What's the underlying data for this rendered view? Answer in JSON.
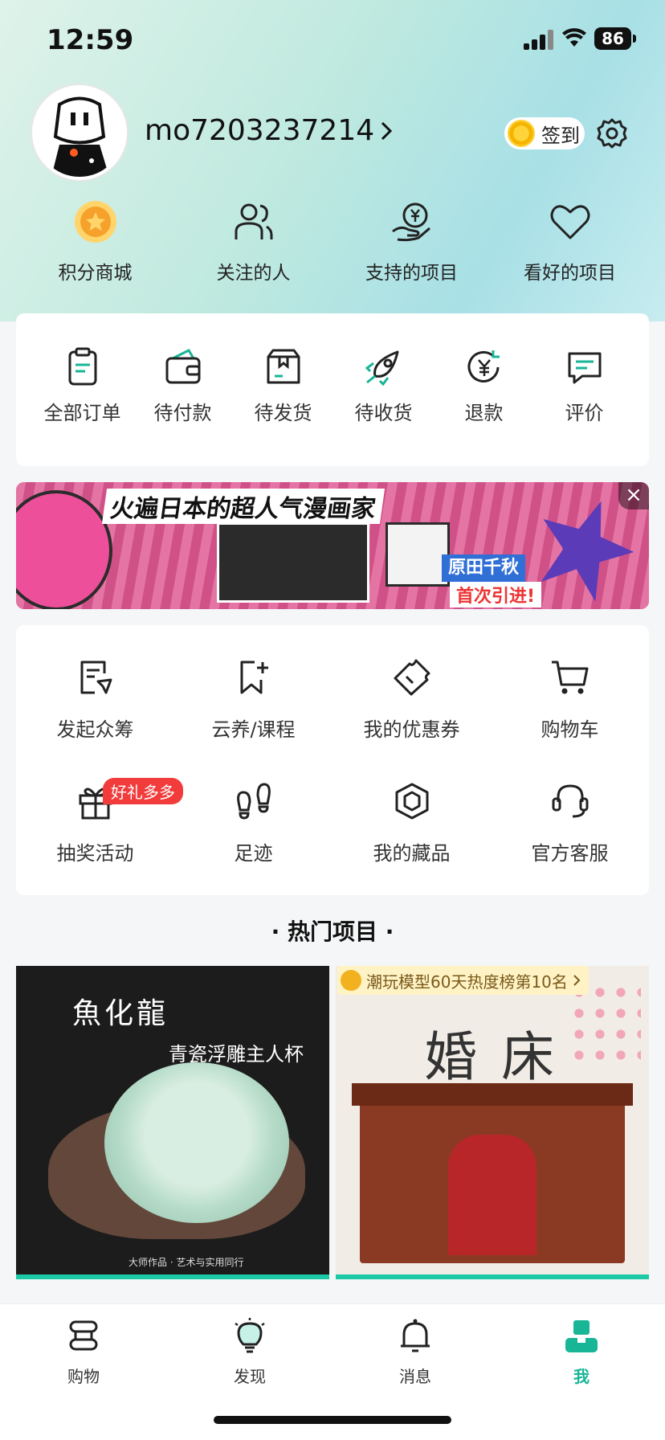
{
  "status_bar": {
    "time": "12:59",
    "battery": "86"
  },
  "profile": {
    "username": "mo7203237214",
    "signin_label": "签到"
  },
  "quick_links": [
    {
      "label": "积分商城",
      "icon": "points-mall-icon"
    },
    {
      "label": "关注的人",
      "icon": "following-icon"
    },
    {
      "label": "支持的项目",
      "icon": "supported-projects-icon"
    },
    {
      "label": "看好的项目",
      "icon": "favorite-heart-icon"
    }
  ],
  "orders": [
    {
      "label": "全部订单"
    },
    {
      "label": "待付款"
    },
    {
      "label": "待发货"
    },
    {
      "label": "待收货"
    },
    {
      "label": "退款"
    },
    {
      "label": "评价"
    }
  ],
  "banner": {
    "title": "火遍日本的超人气漫画家",
    "subtitle": "原田千秋",
    "subtitle2": "首次引进!",
    "close": "×"
  },
  "tools": {
    "row1": [
      {
        "label": "发起众筹"
      },
      {
        "label": "云养/课程"
      },
      {
        "label": "我的优惠券"
      },
      {
        "label": "购物车"
      }
    ],
    "row2": [
      {
        "label": "抽奖活动",
        "badge": "好礼多多"
      },
      {
        "label": "足迹"
      },
      {
        "label": "我的藏品"
      },
      {
        "label": "官方客服"
      }
    ]
  },
  "hot_section": {
    "title": "· 热门项目 ·"
  },
  "projects": [
    {
      "title_art": "魚化龍",
      "subtitle_art": "青瓷浮雕主人杯",
      "footer_art": "大师作品 · 艺术与实用同行"
    },
    {
      "rank_badge": "潮玩模型60天热度榜第10名",
      "title_art": "婚床"
    }
  ],
  "tabbar": [
    {
      "label": "购物"
    },
    {
      "label": "发现"
    },
    {
      "label": "消息"
    },
    {
      "label": "我"
    }
  ],
  "colors": {
    "accent": "#18b597",
    "badge_red": "#f23b3b"
  }
}
